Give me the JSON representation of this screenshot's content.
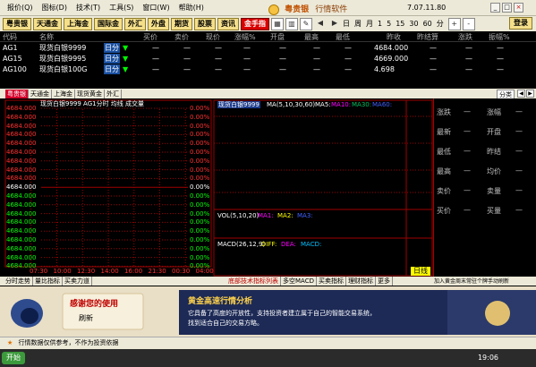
{
  "menu": [
    "报价(Q)",
    "图标(D)",
    "技术(T)",
    "工具(S)",
    "窗口(W)",
    "帮助(H)"
  ],
  "brand": {
    "name": "粤贵银",
    "subtitle": "行情软件",
    "version": "7.07.11.80"
  },
  "toolbar": {
    "buttons": [
      "粤贵银",
      "天通金",
      "上海金",
      "国际金",
      "外汇",
      "外盘",
      "期货",
      "股票",
      "资讯"
    ],
    "gold_button": "金手指",
    "periods": [
      "日",
      "周",
      "月",
      "1",
      "5",
      "15",
      "30",
      "60",
      "分"
    ],
    "login": "登录"
  },
  "quote_table": {
    "headers": [
      "代码",
      "名称",
      "买价",
      "卖价",
      "现价",
      "涨幅%",
      "开盘",
      "最高",
      "最低",
      "昨收",
      "昨结算",
      "涨跌",
      "振幅%"
    ],
    "rows": [
      {
        "code": "AG1",
        "name": "现货白银9999",
        "tag": "日分",
        "arrow": "▼",
        "prev_close": "4684.000"
      },
      {
        "code": "AG15",
        "name": "现货白银9995",
        "tag": "日分",
        "arrow": "▼",
        "prev_close": "4669.000"
      },
      {
        "code": "AG100",
        "name": "现货白银100G",
        "tag": "日分",
        "arrow": "▼",
        "prev_close": "4.698"
      }
    ],
    "dash": "—"
  },
  "tabs1": [
    "粤贵银",
    "天通金",
    "上海金",
    "现货黄金",
    "外汇"
  ],
  "tabs1_right": "分类",
  "intraday": {
    "title": "现货白银9999 AG1分时 均线 成交量",
    "y_labels": [
      "4684.000",
      "4684.000",
      "4684.000",
      "4684.000",
      "4684.000",
      "4684.000",
      "4684.000",
      "4684.000",
      "4684.000",
      "4684.000",
      "4684.000",
      "4684.000",
      "4684.000",
      "4684.000",
      "4684.000",
      "4684.000",
      "4684.000",
      "4684.000",
      "4684.000"
    ],
    "pct_labels": [
      "0.00%",
      "0.00%",
      "0.00%",
      "0.00%",
      "0.00%",
      "0.00%",
      "0.00%",
      "0.00%",
      "0.00%",
      "0.00%",
      "0.00%",
      "0.00%",
      "0.00%",
      "0.00%",
      "0.00%",
      "0.00%",
      "0.00%",
      "0.00%",
      "0.00%"
    ],
    "x_labels": [
      "07:30",
      "10:00",
      "12:30",
      "14:00",
      "16:00",
      "21:30",
      "00:30",
      "04:00"
    ]
  },
  "kline": {
    "title_name": "现货白银9999",
    "ma_label": "MA(5,10,30,60)",
    "ma_items": [
      "MA5:",
      "MA10:",
      "MA30:",
      "MA60:"
    ],
    "vol_label": "VOL(5,10,20)",
    "vol_items": [
      "MA1:",
      "MA2:",
      "MA3:"
    ],
    "macd_label": "MACD(26,12,9)",
    "macd_items": [
      "DIFF:",
      "DEA:",
      "MACD:"
    ],
    "period_badge": "日线"
  },
  "right_panel": [
    [
      "涨跌",
      "—",
      "涨幅",
      "—"
    ],
    [
      "最新",
      "—",
      "开盘",
      "—"
    ],
    [
      "最低",
      "—",
      "昨结",
      "—"
    ],
    [
      "最高",
      "—",
      "均价",
      "—"
    ],
    [
      "卖价",
      "—",
      "卖量",
      "—"
    ],
    [
      "买价",
      "—",
      "买量",
      "—"
    ]
  ],
  "tabs2": [
    "分时走势",
    "量比指标",
    "买卖力道"
  ],
  "tabs2_k": [
    "底部技术指标列表",
    "多空MACD",
    "买卖指标",
    "理财指标",
    "更多"
  ],
  "tabs2_right": "加入黄金周末常驻个牌手动刷新",
  "ad": {
    "thanks": "感谢您的使用",
    "refresh": "刷新",
    "headline": "黄金高速行情分析",
    "body_line1": "它具备了高度的开放性，支持投资者建立属于自己的智能交易系统，",
    "body_line2": "找到适合自己的交易方略。"
  },
  "statusbar": "行情数据仅供参考，不作为投资依据",
  "bottombar": {
    "start": "开始",
    "clock": "19:06"
  },
  "colors": {
    "grid": "#a00000",
    "up": "#ff3030",
    "green": "#00ff00",
    "cyan": "#00c0ff",
    "magenta": "#ff00ff",
    "yellow": "#ffff00"
  }
}
